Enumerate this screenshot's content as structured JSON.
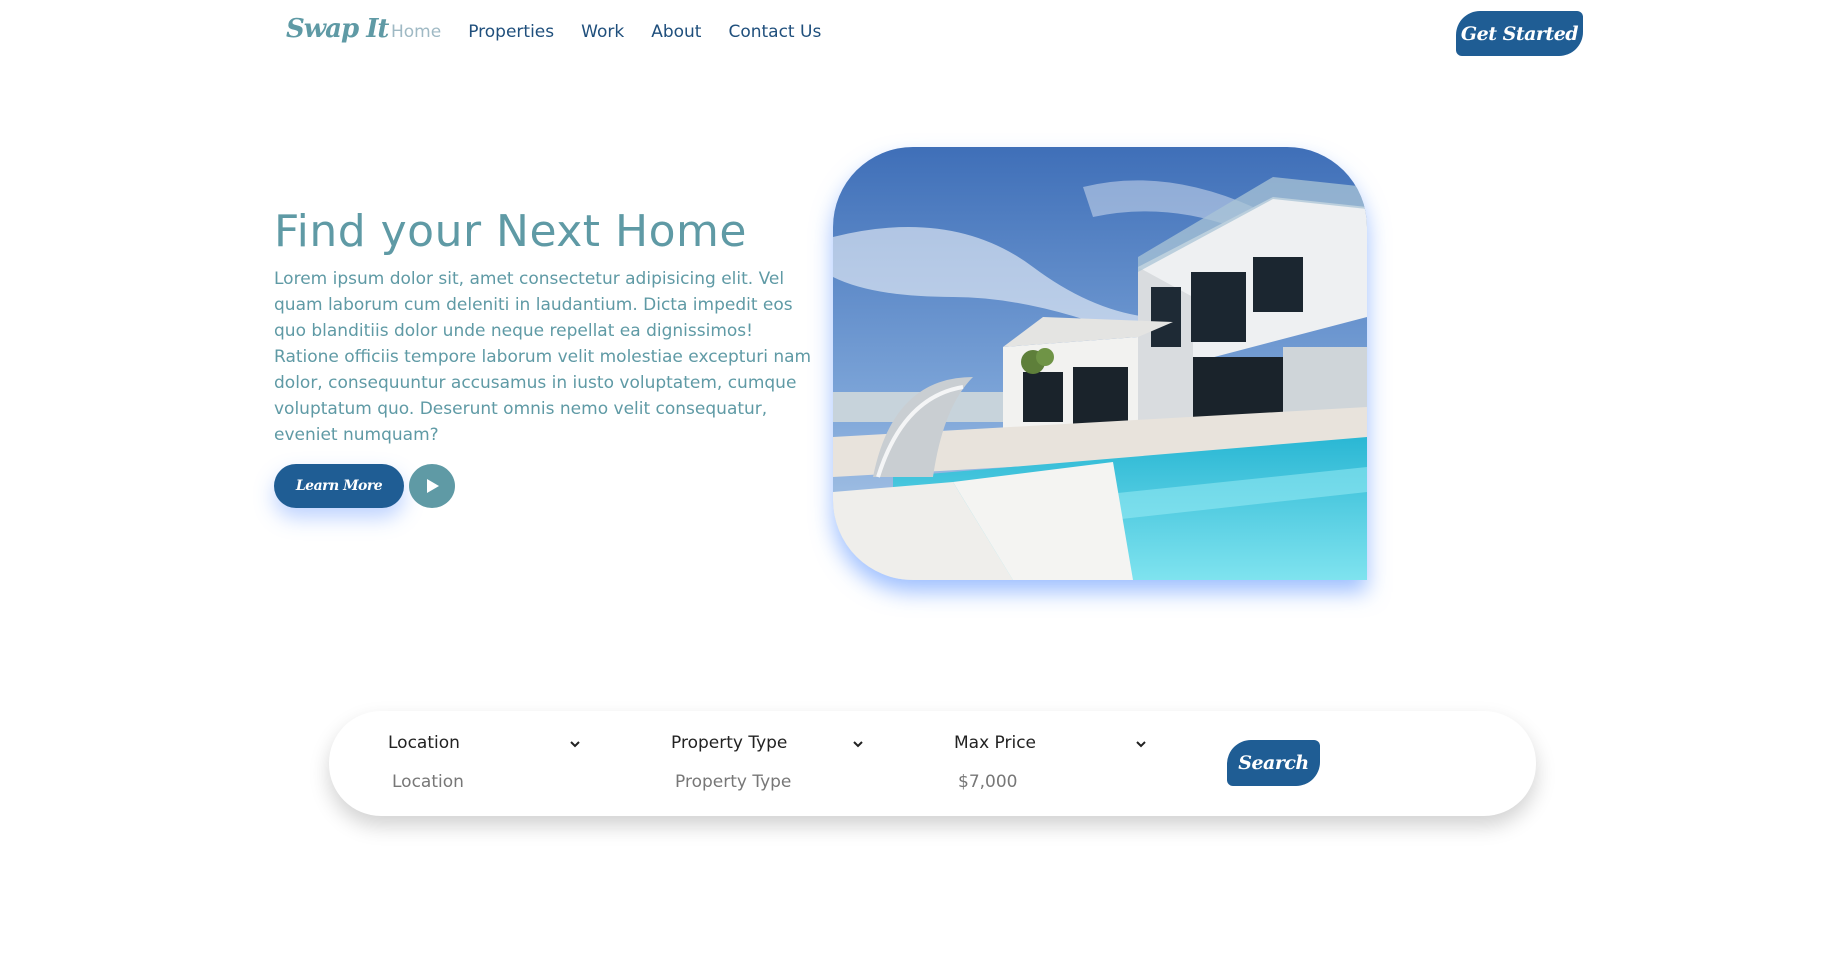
{
  "brand": {
    "logo_text": "Swap It"
  },
  "nav": {
    "items": [
      {
        "label": "Home",
        "active": true
      },
      {
        "label": "Properties"
      },
      {
        "label": "Work"
      },
      {
        "label": "About"
      },
      {
        "label": "Contact Us"
      }
    ],
    "cta_label": "Get Started"
  },
  "hero": {
    "title": "Find your Next Home",
    "body": "Lorem ipsum dolor sit, amet consectetur adipisicing elit. Vel quam laborum cum deleniti in laudantium. Dicta impedit eos quo blanditiis dolor unde neque repellat ea dignissimos! Ratione officiis tempore laborum velit molestiae excepturi nam dolor, consequuntur accusamus in iusto voluptatem, cumque voluptatum quo. Deserunt omnis nemo velit consequatur, eveniet numquam?",
    "learn_more_label": "Learn More",
    "play_icon": "play-icon",
    "image_subject": "modern-villa-with-pool"
  },
  "search": {
    "fields": [
      {
        "label": "Location",
        "value": "Location"
      },
      {
        "label": "Property Type",
        "value": "Property Type"
      },
      {
        "label": "Max Price",
        "value": "$7,000"
      }
    ],
    "button_label": "Search"
  },
  "colors": {
    "primary": "#1f5d94",
    "accent": "#5f9aa5",
    "nav_active": "#9fb9c4",
    "image_glow": "#508cff"
  }
}
